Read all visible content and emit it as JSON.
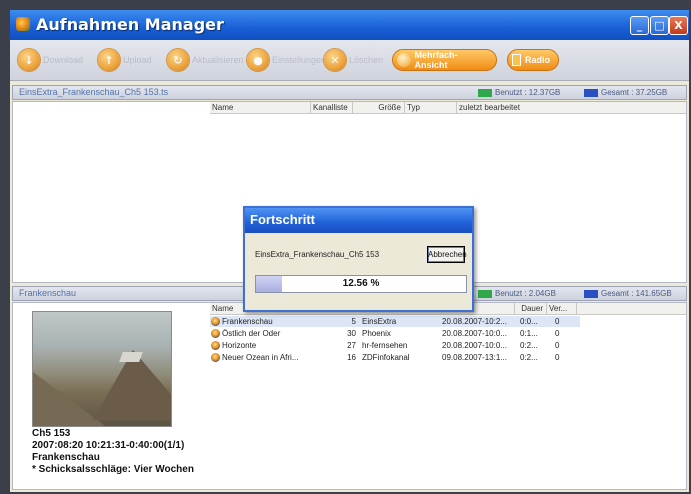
{
  "window": {
    "title": "Aufnahmen Manager",
    "controls": {
      "minimize": "_",
      "maximize": "□",
      "close": "X"
    }
  },
  "toolbar": {
    "buttons": [
      {
        "label": "Download",
        "icon": "download-icon"
      },
      {
        "label": "Upload",
        "icon": "upload-icon"
      },
      {
        "label": "Aktualisieren",
        "icon": "refresh-icon"
      },
      {
        "label": "Einstellungen",
        "icon": "record-icon"
      },
      {
        "label": "Löschen",
        "icon": "delete-icon"
      }
    ],
    "multiview_label": "Mehrfach-Ansicht",
    "radio_label": "Radio"
  },
  "top_panel": {
    "name": "EinsExtra_Frankenschau_Ch5 153.ts",
    "used": "Benutzt : 12.37GB",
    "total": "Gesamt : 37.25GB",
    "columns": [
      "Name",
      "Kanalliste",
      "Größe",
      "Typ",
      "zuletzt bearbeitet"
    ]
  },
  "bottom_panel": {
    "name": "Frankenschau",
    "used": "Benutzt : 2.04GB",
    "total": "Gesamt : 141.65GB",
    "columns": [
      "Name",
      "Dauer",
      "Ver..."
    ],
    "rows": [
      {
        "name": "Frankenschau",
        "num": "5",
        "channel": "EinsExtra",
        "date": "20.08.2007-10:2...",
        "duration": "0:0...",
        "ver": "0"
      },
      {
        "name": "Östlich der Oder",
        "num": "30",
        "channel": "Phoenix",
        "date": "20.08.2007-10:0...",
        "duration": "0:1...",
        "ver": "0"
      },
      {
        "name": "Horizonte",
        "num": "27",
        "channel": "hr-fernsehen",
        "date": "20.08.2007-10:0...",
        "duration": "0:2...",
        "ver": "0"
      },
      {
        "name": "Neuer Ozean in Afri...",
        "num": "16",
        "channel": "ZDFinfokanal",
        "date": "09.08.2007-13:1...",
        "duration": "0:2...",
        "ver": "0"
      }
    ]
  },
  "info": {
    "line1": "Ch5 153",
    "line2": "2007:08:20 10:21:31-0:40:00(1/1)",
    "line3": "Frankenschau",
    "line4": "* Schicksalsschläge: Vier Wochen"
  },
  "dialog": {
    "title": "Fortschritt",
    "file": "EinsExtra_Frankenschau_Ch5 153",
    "cancel": "Abbrechen",
    "progress_text": "12.56 %",
    "progress_fraction": 0.1256
  },
  "colors": {
    "used": "#2ea84a",
    "total": "#2a4fc0",
    "accent": "#f29a1e"
  }
}
